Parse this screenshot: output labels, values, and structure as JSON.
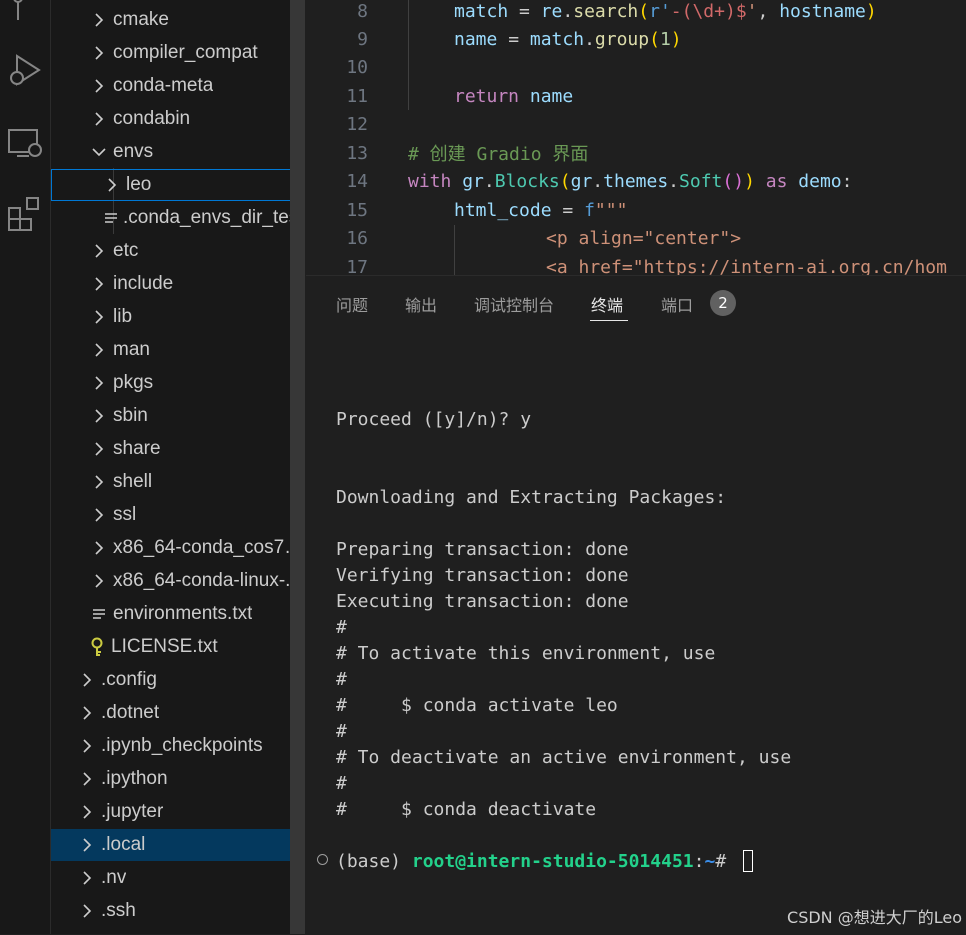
{
  "explorer": {
    "items": [
      {
        "label": "cmake",
        "type": "folder",
        "expanded": false
      },
      {
        "label": "compiler_compat",
        "type": "folder",
        "expanded": false
      },
      {
        "label": "conda-meta",
        "type": "folder",
        "expanded": false
      },
      {
        "label": "condabin",
        "type": "folder",
        "expanded": false
      },
      {
        "label": "envs",
        "type": "folder",
        "expanded": true
      },
      {
        "label": "leo",
        "type": "folder",
        "expanded": false
      },
      {
        "label": ".conda_envs_dir_test",
        "type": "file"
      },
      {
        "label": "etc",
        "type": "folder",
        "expanded": false
      },
      {
        "label": "include",
        "type": "folder",
        "expanded": false
      },
      {
        "label": "lib",
        "type": "folder",
        "expanded": false
      },
      {
        "label": "man",
        "type": "folder",
        "expanded": false
      },
      {
        "label": "pkgs",
        "type": "folder",
        "expanded": false
      },
      {
        "label": "sbin",
        "type": "folder",
        "expanded": false
      },
      {
        "label": "share",
        "type": "folder",
        "expanded": false
      },
      {
        "label": "shell",
        "type": "folder",
        "expanded": false
      },
      {
        "label": "ssl",
        "type": "folder",
        "expanded": false
      },
      {
        "label": "x86_64-conda_cos7-...",
        "type": "folder",
        "expanded": false
      },
      {
        "label": "x86_64-conda-linux-...",
        "type": "folder",
        "expanded": false
      },
      {
        "label": "environments.txt",
        "type": "file"
      },
      {
        "label": "LICENSE.txt",
        "type": "license-file"
      },
      {
        "label": ".config",
        "type": "folder",
        "expanded": false
      },
      {
        "label": ".dotnet",
        "type": "folder",
        "expanded": false
      },
      {
        "label": ".ipynb_checkpoints",
        "type": "folder",
        "expanded": false
      },
      {
        "label": ".ipython",
        "type": "folder",
        "expanded": false
      },
      {
        "label": ".jupyter",
        "type": "folder",
        "expanded": false
      },
      {
        "label": ".local",
        "type": "folder",
        "expanded": false
      },
      {
        "label": ".nv",
        "type": "folder",
        "expanded": false
      },
      {
        "label": ".ssh",
        "type": "folder",
        "expanded": false
      }
    ]
  },
  "editor": {
    "lines": [
      {
        "num": "8",
        "text": "    match = re.search(r'-(\\d+)$', hostname)"
      },
      {
        "num": "9",
        "text": "    name = match.group(1)"
      },
      {
        "num": "10",
        "text": ""
      },
      {
        "num": "11",
        "text": "    return name"
      },
      {
        "num": "12",
        "text": ""
      },
      {
        "num": "13",
        "text": "# 创建 Gradio 界面"
      },
      {
        "num": "14",
        "text": "with gr.Blocks(gr.themes.Soft()) as demo:"
      },
      {
        "num": "15",
        "text": "    html_code = f\"\"\""
      },
      {
        "num": "16",
        "text": "            <p align=\"center\">"
      },
      {
        "num": "17",
        "text": "            <a href=\"https://intern-ai.org.cn/hom"
      }
    ],
    "tokens": {
      "l8": [
        "match",
        " = ",
        "re",
        ".",
        "search",
        "(",
        "r'",
        "-(\\d+)$",
        "'",
        ", ",
        "hostname",
        ")"
      ],
      "l9": [
        "name",
        " = ",
        "match",
        ".",
        "group",
        "(",
        "1",
        ")"
      ],
      "l11": [
        "return",
        " ",
        "name"
      ],
      "l13": [
        "# 创建 Gradio 界面"
      ],
      "l14": [
        "with",
        " ",
        "gr",
        ".",
        "Blocks",
        "(",
        "gr",
        ".",
        "themes",
        ".",
        "Soft",
        "()",
        ")",
        " ",
        "as",
        " ",
        "demo",
        ":"
      ],
      "l15": [
        "html_code",
        " = ",
        "f",
        "\"\"\""
      ],
      "l16": [
        "<p align=\"center\">"
      ],
      "l17": [
        "<a href=\"https://intern-ai.org.cn/hom"
      ]
    }
  },
  "panel": {
    "tabs": [
      "问题",
      "输出",
      "调试控制台",
      "终端",
      "端口"
    ],
    "active_tab": "终端",
    "ports_badge": "2"
  },
  "terminal": {
    "lines": [
      "Proceed ([y]/n)? y",
      "Downloading and Extracting Packages:",
      "Preparing transaction: done",
      "Verifying transaction: done",
      "Executing transaction: done",
      "#",
      "# To activate this environment, use",
      "#",
      "#     $ conda activate leo",
      "#",
      "# To deactivate an active environment, use",
      "#",
      "#     $ conda deactivate"
    ],
    "prompt_prefix": "(base) ",
    "prompt_user_host": "root@intern-studio-5014451",
    "prompt_sep": ":",
    "prompt_path": "~",
    "prompt_symbol": "# "
  },
  "watermark": "CSDN @想进大厂的Leo",
  "colors": {
    "background": "#1f1f1f",
    "sidebar": "#181818",
    "selection": "#04395e",
    "focus_border": "#0078d4"
  }
}
